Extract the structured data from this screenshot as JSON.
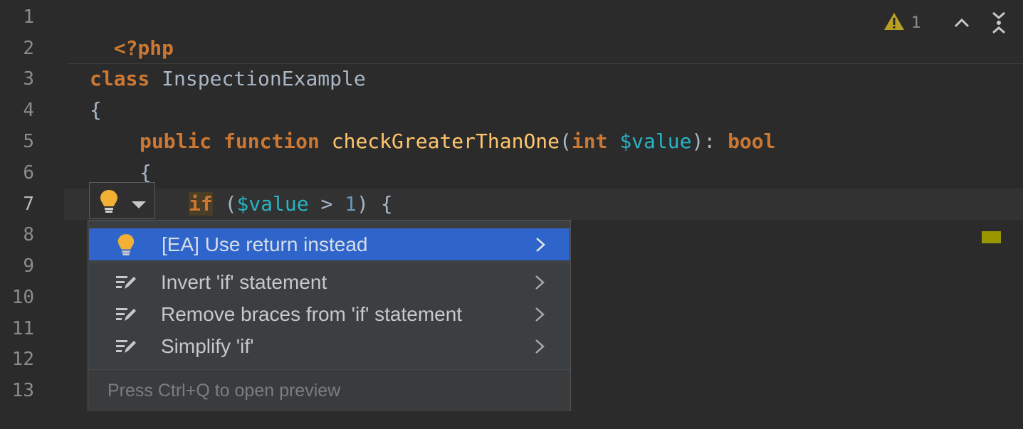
{
  "editor": {
    "line_numbers": [
      "1",
      "2",
      "3",
      "4",
      "5",
      "6",
      "7",
      "8",
      "9",
      "10",
      "11",
      "12",
      "13"
    ],
    "code": {
      "line1": {
        "tag": "<?php"
      },
      "line3": {
        "keyword": "class",
        "name": " InspectionExample"
      },
      "line4": {
        "brace": "{"
      },
      "line5": {
        "kw_public": "public",
        "kw_function": " function",
        "fn_name": " checkGreaterThanOne",
        "paren_open": "(",
        "type_int": "int",
        "var": " $value",
        "paren_close": "): ",
        "ret_type": "bool"
      },
      "line6": {
        "brace": "{"
      },
      "line7": {
        "kw_if": "if",
        "paren_open": " (",
        "var": "$value",
        "op": " > ",
        "num": "1",
        "rest": ") {"
      }
    }
  },
  "inspection_widget": {
    "warning_count": "1",
    "icons": [
      "warning-icon",
      "chevron-up-icon",
      "expand-icon"
    ]
  },
  "marker_colors": {
    "warning_marker": "#999600"
  },
  "intention_button": {
    "icons": [
      "bulb-icon",
      "caret-down-icon"
    ]
  },
  "popup": {
    "items": [
      {
        "label": "[EA] Use return instead",
        "icon": "bulb-icon"
      },
      {
        "label": "Invert 'if' statement",
        "icon": "edit-icon"
      },
      {
        "label": "Remove braces from 'if' statement",
        "icon": "edit-icon"
      },
      {
        "label": "Simplify 'if'",
        "icon": "edit-icon"
      }
    ],
    "footer": "Press Ctrl+Q to open preview",
    "selected_color": "#2f65ca"
  }
}
